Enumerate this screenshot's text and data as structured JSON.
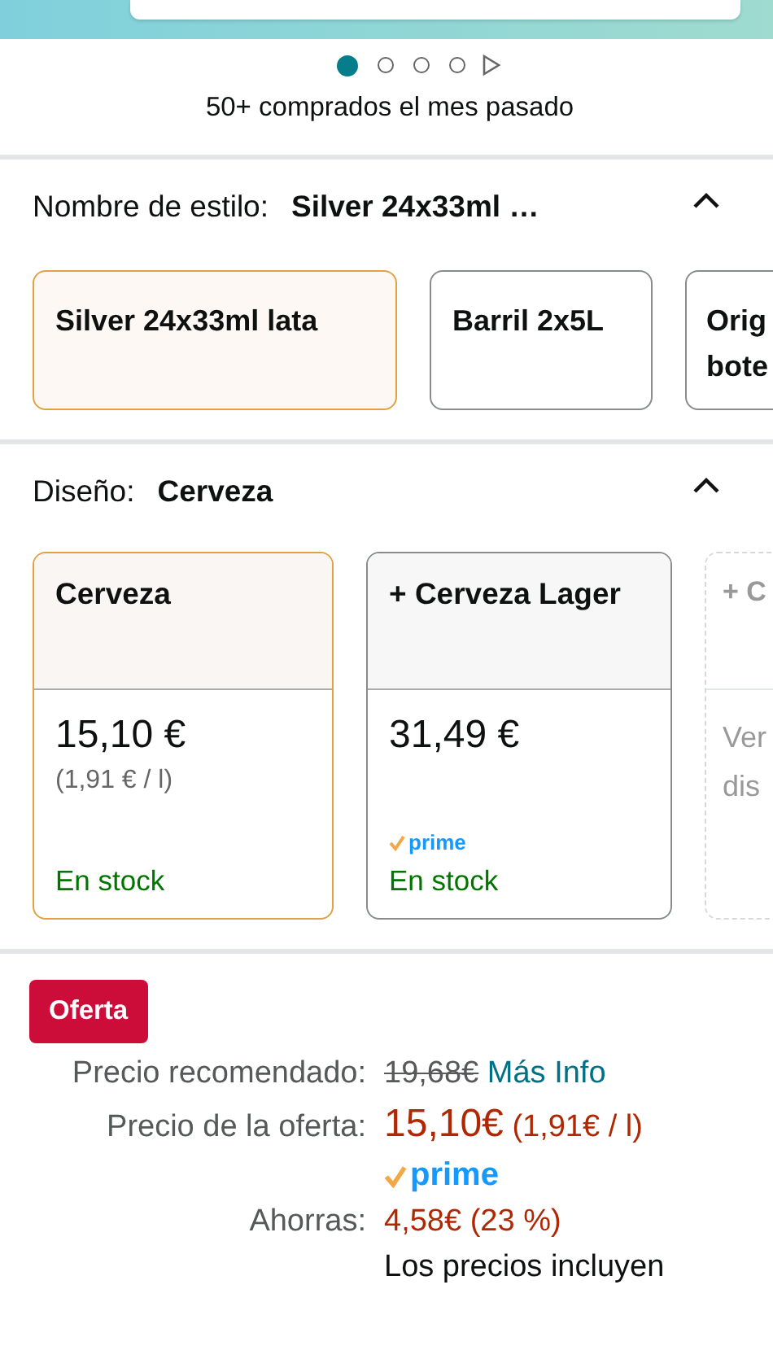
{
  "carousel": {
    "dots": [
      {
        "selected": true
      },
      {
        "selected": false
      },
      {
        "selected": false
      },
      {
        "selected": false
      }
    ]
  },
  "purchase_note": "50+ comprados el mes pasado",
  "style_section": {
    "label": "Nombre de estilo:",
    "value": "Silver 24x33ml …",
    "expanded": true,
    "options": [
      {
        "label": "Silver 24x33ml lata",
        "selected": true
      },
      {
        "label": "Barril 2x5L",
        "selected": false
      },
      {
        "label": "Orig bote",
        "selected": false
      }
    ]
  },
  "design_section": {
    "label": "Diseño:",
    "value": "Cerveza",
    "expanded": true,
    "options": [
      {
        "title": "Cerveza",
        "price": "15,10 €",
        "unit_price": "(1,91 € / l)",
        "prime": false,
        "stock": "En stock",
        "selected": true,
        "available": true
      },
      {
        "title": "+ Cerveza Lager",
        "price": "31,49 €",
        "prime": true,
        "prime_label": "prime",
        "stock": "En stock",
        "selected": false,
        "available": true
      },
      {
        "title": "+ C",
        "note": "Ver dis",
        "selected": false,
        "available": false
      }
    ]
  },
  "offer": {
    "badge": "Oferta",
    "rows": [
      {
        "kind": "list",
        "label": "Precio recomendado:",
        "value": "19,68€",
        "link": "Más Info"
      },
      {
        "kind": "deal",
        "label": "Precio de la oferta:",
        "value": "15,10€",
        "unit_price": "(1,91€ / l)"
      },
      {
        "kind": "prime",
        "value": "prime"
      },
      {
        "kind": "savings",
        "label": "Ahorras:",
        "value": "4,58€ (23 %)"
      },
      {
        "kind": "note",
        "value": "Los precios incluyen"
      }
    ]
  }
}
